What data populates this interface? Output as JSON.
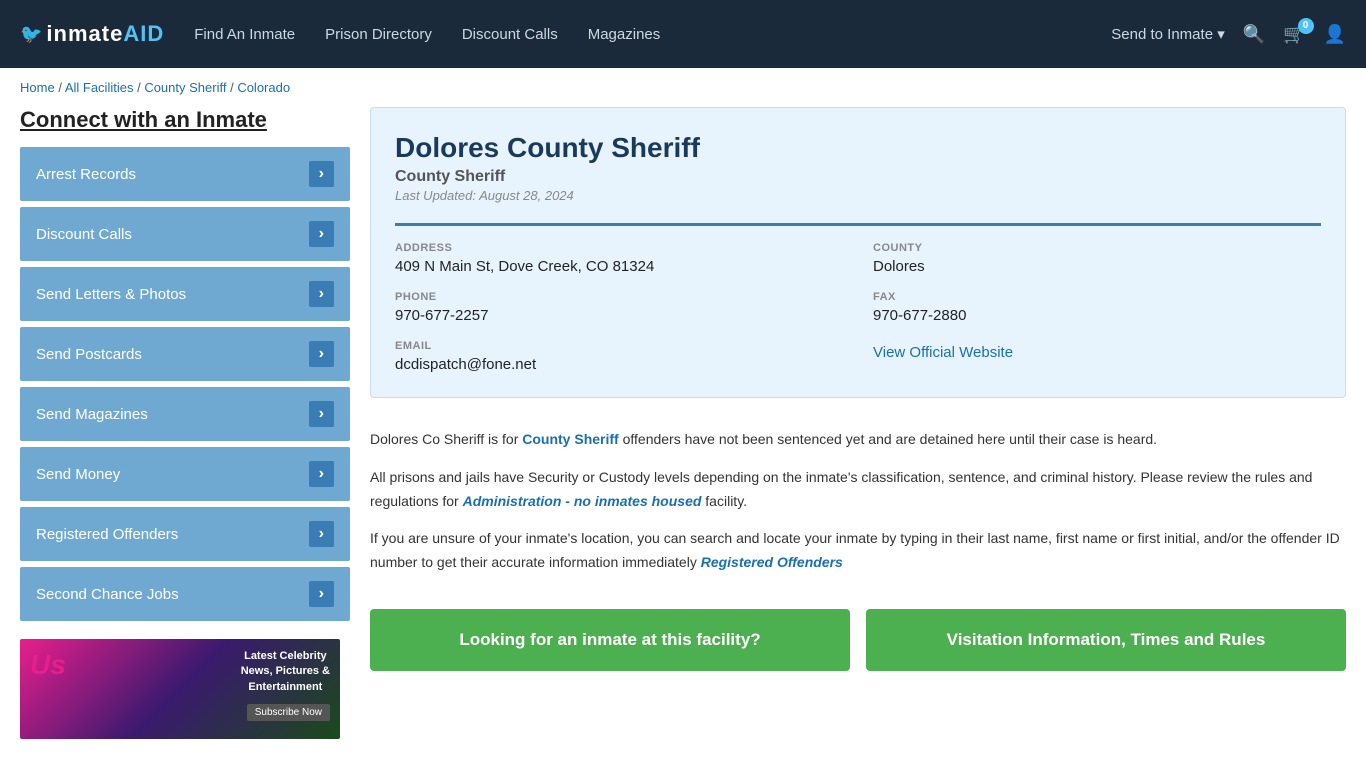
{
  "navbar": {
    "logo": "inmateAID",
    "logo_bird": "🐦",
    "nav_links": [
      {
        "label": "Find An Inmate",
        "id": "find-inmate"
      },
      {
        "label": "Prison Directory",
        "id": "prison-directory"
      },
      {
        "label": "Discount Calls",
        "id": "discount-calls"
      },
      {
        "label": "Magazines",
        "id": "magazines"
      }
    ],
    "send_to_inmate": "Send to Inmate ▾",
    "cart_count": "0",
    "search_icon": "🔍",
    "cart_icon": "🛒",
    "user_icon": "👤"
  },
  "breadcrumb": {
    "home": "Home",
    "separator1": " / ",
    "all_facilities": "All Facilities",
    "separator2": " / ",
    "county_sheriff": "County Sheriff",
    "separator3": " / ",
    "colorado": "Colorado"
  },
  "sidebar": {
    "heading": "Connect with an Inmate",
    "items": [
      {
        "label": "Arrest Records"
      },
      {
        "label": "Discount Calls"
      },
      {
        "label": "Send Letters & Photos"
      },
      {
        "label": "Send Postcards"
      },
      {
        "label": "Send Magazines"
      },
      {
        "label": "Send Money"
      },
      {
        "label": "Registered Offenders"
      },
      {
        "label": "Second Chance Jobs"
      }
    ],
    "ad": {
      "logo": "Us",
      "line1": "Latest Celebrity",
      "line2": "News, Pictures &",
      "line3": "Entertainment",
      "cta": "Subscribe Now"
    }
  },
  "facility": {
    "name": "Dolores County Sheriff",
    "type": "County Sheriff",
    "last_updated": "Last Updated: August 28, 2024",
    "address_label": "ADDRESS",
    "address": "409 N Main St, Dove Creek, CO 81324",
    "county_label": "COUNTY",
    "county": "Dolores",
    "phone_label": "PHONE",
    "phone": "970-677-2257",
    "fax_label": "FAX",
    "fax": "970-677-2880",
    "email_label": "EMAIL",
    "email": "dcdispatch@fone.net",
    "website_link": "View Official Website"
  },
  "description": {
    "p1_start": "Dolores Co Sheriff is for ",
    "p1_bold": "County Sheriff",
    "p1_end": " offenders have not been sentenced yet and are detained here until their case is heard.",
    "p2": "All prisons and jails have Security or Custody levels depending on the inmate's classification, sentence, and criminal history. Please review the rules and regulations for ",
    "p2_bold": "Administration - no inmates housed",
    "p2_end": " facility.",
    "p3_start": "If you are unsure of your inmate's location, you can search and locate your inmate by typing in their last name, first name or first initial, and/or the offender ID number to get their accurate information immediately ",
    "p3_link": "Registered Offenders"
  },
  "buttons": {
    "looking": "Looking for an inmate at this facility?",
    "visitation": "Visitation Information, Times and Rules"
  }
}
